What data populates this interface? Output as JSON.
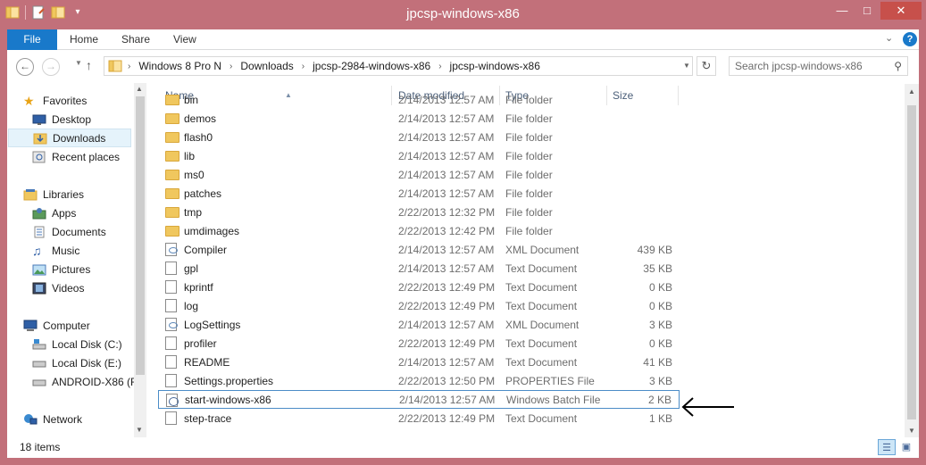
{
  "window": {
    "title": "jpcsp-windows-x86"
  },
  "ribbon": {
    "tabs": [
      "File",
      "Home",
      "Share",
      "View"
    ],
    "help": "?"
  },
  "address": {
    "crumbs": [
      "Windows 8 Pro N",
      "Downloads",
      "jpcsp-2984-windows-x86",
      "jpcsp-windows-x86"
    ],
    "search_placeholder": "Search jpcsp-windows-x86"
  },
  "nav": {
    "favorites": {
      "label": "Favorites",
      "items": [
        "Desktop",
        "Downloads",
        "Recent places"
      ],
      "selected": "Downloads"
    },
    "libraries": {
      "label": "Libraries",
      "items": [
        "Apps",
        "Documents",
        "Music",
        "Pictures",
        "Videos"
      ]
    },
    "computer": {
      "label": "Computer",
      "items": [
        "Local Disk (C:)",
        "Local Disk (E:)",
        "ANDROID-X86 (F"
      ]
    },
    "network": {
      "label": "Network"
    }
  },
  "columns": {
    "name": "Name",
    "date": "Date modified",
    "type": "Type",
    "size": "Size"
  },
  "files": [
    {
      "name": "bin",
      "date": "2/14/2013 12:57 AM",
      "type": "File folder",
      "size": "",
      "icon": "folder-icon"
    },
    {
      "name": "demos",
      "date": "2/14/2013 12:57 AM",
      "type": "File folder",
      "size": "",
      "icon": "folder-icon"
    },
    {
      "name": "flash0",
      "date": "2/14/2013 12:57 AM",
      "type": "File folder",
      "size": "",
      "icon": "folder-icon"
    },
    {
      "name": "lib",
      "date": "2/14/2013 12:57 AM",
      "type": "File folder",
      "size": "",
      "icon": "folder-icon"
    },
    {
      "name": "ms0",
      "date": "2/14/2013 12:57 AM",
      "type": "File folder",
      "size": "",
      "icon": "folder-icon"
    },
    {
      "name": "patches",
      "date": "2/14/2013 12:57 AM",
      "type": "File folder",
      "size": "",
      "icon": "folder-icon"
    },
    {
      "name": "tmp",
      "date": "2/22/2013 12:32 PM",
      "type": "File folder",
      "size": "",
      "icon": "folder-icon"
    },
    {
      "name": "umdimages",
      "date": "2/22/2013 12:42 PM",
      "type": "File folder",
      "size": "",
      "icon": "folder-icon"
    },
    {
      "name": "Compiler",
      "date": "2/14/2013 12:57 AM",
      "type": "XML Document",
      "size": "439 KB",
      "icon": "xml-file-icon"
    },
    {
      "name": "gpl",
      "date": "2/14/2013 12:57 AM",
      "type": "Text Document",
      "size": "35 KB",
      "icon": "text-file-icon"
    },
    {
      "name": "kprintf",
      "date": "2/22/2013 12:49 PM",
      "type": "Text Document",
      "size": "0 KB",
      "icon": "text-file-icon"
    },
    {
      "name": "log",
      "date": "2/22/2013 12:49 PM",
      "type": "Text Document",
      "size": "0 KB",
      "icon": "text-file-icon"
    },
    {
      "name": "LogSettings",
      "date": "2/14/2013 12:57 AM",
      "type": "XML Document",
      "size": "3 KB",
      "icon": "xml-file-icon"
    },
    {
      "name": "profiler",
      "date": "2/22/2013 12:49 PM",
      "type": "Text Document",
      "size": "0 KB",
      "icon": "text-file-icon"
    },
    {
      "name": "README",
      "date": "2/14/2013 12:57 AM",
      "type": "Text Document",
      "size": "41 KB",
      "icon": "text-file-icon"
    },
    {
      "name": "Settings.properties",
      "date": "2/22/2013 12:50 PM",
      "type": "PROPERTIES File",
      "size": "3 KB",
      "icon": "file-icon"
    },
    {
      "name": "start-windows-x86",
      "date": "2/14/2013 12:57 AM",
      "type": "Windows Batch File",
      "size": "2 KB",
      "icon": "batch-file-icon",
      "selected": true
    },
    {
      "name": "step-trace",
      "date": "2/22/2013 12:49 PM",
      "type": "Text Document",
      "size": "1 KB",
      "icon": "text-file-icon"
    }
  ],
  "status": {
    "count": "18 items"
  },
  "colors": {
    "frame": "#c2707a",
    "accent": "#1979ca",
    "close": "#c7504b",
    "selection_border": "#4b8cc7"
  }
}
